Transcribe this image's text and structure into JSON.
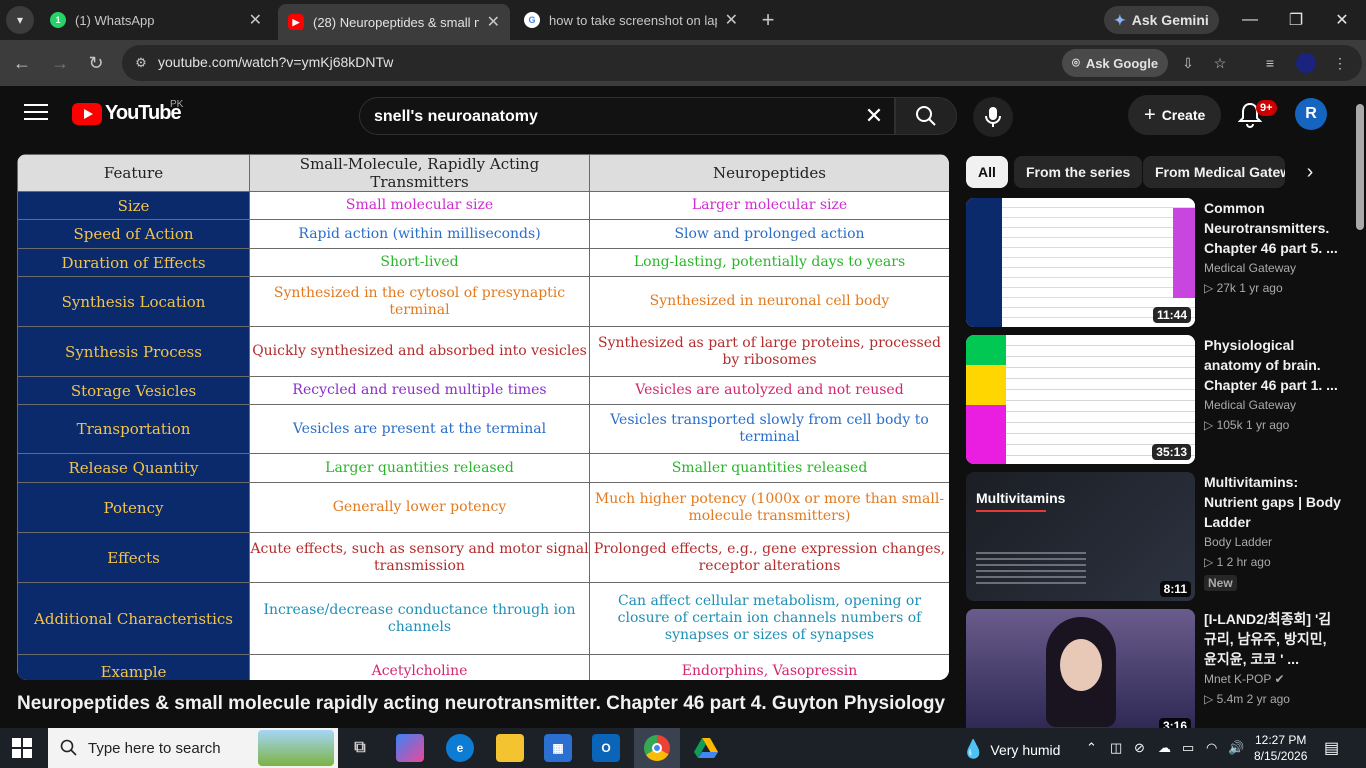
{
  "browser": {
    "tabs": [
      {
        "title": "(1) WhatsApp",
        "fav_text": "1",
        "color": "#25d366"
      },
      {
        "title": "(28) Neuropeptides & small mo",
        "fav_text": "",
        "color": "#ff0000"
      },
      {
        "title": "how to take screenshot on lapt",
        "fav_text": "G",
        "color": "#4285f4"
      }
    ],
    "ask_gemini": "Ask Gemini",
    "url": "youtube.com/watch?v=ymKj68kDNTw",
    "ask_google": "Ask Google"
  },
  "youtube": {
    "logo_text": "YouTube",
    "region": "PK",
    "search_query": "snell's neuroanatomy",
    "create_label": "Create",
    "notif_count": "9+",
    "avatar_letter": "R",
    "video_title": "Neuropeptides & small molecule rapidly acting neurotransmitter. Chapter 46 part 4. Guyton Physiology"
  },
  "table": {
    "headers": [
      "Feature",
      "Small-Molecule, Rapidly Acting Transmitters",
      "Neuropeptides"
    ],
    "rows": [
      {
        "feature": "Size",
        "small": "Small molecular size",
        "neuro": "Larger molecular size",
        "sc": "c-magenta",
        "nc": "c-magenta"
      },
      {
        "feature": "Speed of Action",
        "small": "Rapid action (within milliseconds)",
        "neuro": "Slow and prolonged action",
        "sc": "c-blue",
        "nc": "c-blue"
      },
      {
        "feature": "Duration of Effects",
        "small": "Short-lived",
        "neuro": "Long-lasting, potentially days to years",
        "sc": "c-green",
        "nc": "c-green"
      },
      {
        "feature": "Synthesis Location",
        "small": "Synthesized in the cytosol of presynaptic terminal",
        "neuro": "Synthesized in neuronal cell body",
        "sc": "c-orange",
        "nc": "c-orange"
      },
      {
        "feature": "Synthesis Process",
        "small": "Quickly synthesized and absorbed into vesicles",
        "neuro": "Synthesized as part of large proteins, processed by ribosomes",
        "sc": "c-red",
        "nc": "c-red"
      },
      {
        "feature": "Storage Vesicles",
        "small": "Recycled and reused multiple times",
        "neuro": "Vesicles are autolyzed and not reused",
        "sc": "c-purple",
        "nc": "c-pink"
      },
      {
        "feature": "Transportation",
        "small": "Vesicles are present at the terminal",
        "neuro": "Vesicles transported slowly from cell body to terminal",
        "sc": "c-blue",
        "nc": "c-blue"
      },
      {
        "feature": "Release Quantity",
        "small": "Larger quantities released",
        "neuro": "Smaller quantities released",
        "sc": "c-green",
        "nc": "c-green"
      },
      {
        "feature": "Potency",
        "small": "Generally lower potency",
        "neuro": "Much higher potency (1000x or more than small-molecule transmitters)",
        "sc": "c-orange",
        "nc": "c-orange"
      },
      {
        "feature": "Effects",
        "small": "Acute effects, such as sensory and motor signal transmission",
        "neuro": "Prolonged effects, e.g., gene expression changes, receptor alterations",
        "sc": "c-red",
        "nc": "c-red"
      },
      {
        "feature": "Additional Characteristics",
        "small": "Increase/decrease conductance through ion channels",
        "neuro": "Can affect cellular metabolism, opening or closure of certain ion channels numbers of synapses or sizes of synapses",
        "sc": "c-teal",
        "nc": "c-teal"
      },
      {
        "feature": "Example",
        "small": "Acetylcholine",
        "neuro": "Endorphins, Vasopressin",
        "sc": "c-pink",
        "nc": "c-pink"
      }
    ]
  },
  "chips": [
    "All",
    "From the series",
    "From Medical Gatew"
  ],
  "recommendations": [
    {
      "title": "Common Neurotransmitters. Chapter 46 part 5. ...",
      "channel": "Medical Gateway",
      "views": "27k",
      "age": "1 yr ago",
      "duration": "11:44",
      "new": ""
    },
    {
      "title": "Physiological anatomy of brain. Chapter 46 part 1. ...",
      "channel": "Medical Gateway",
      "views": "105k",
      "age": "1 yr ago",
      "duration": "35:13",
      "new": ""
    },
    {
      "title": "Multivitamins: Nutrient gaps | Body Ladder",
      "channel": "Body Ladder",
      "views": "1",
      "age": "2 hr ago",
      "duration": "8:11",
      "new": "New",
      "thumb_text": "Multivitamins"
    },
    {
      "title": "[I-LAND2/최종회] '김규리, 남유주, 방지민, 윤지윤, 코코 ' ...",
      "channel": "Mnet K-POP",
      "views": "5.4m",
      "age": "2 yr ago",
      "duration": "3:16",
      "new": ""
    }
  ],
  "taskbar": {
    "search_placeholder": "Type here to search",
    "weather": "Very humid",
    "time": "12:27 PM",
    "date": "8/15/2026"
  }
}
